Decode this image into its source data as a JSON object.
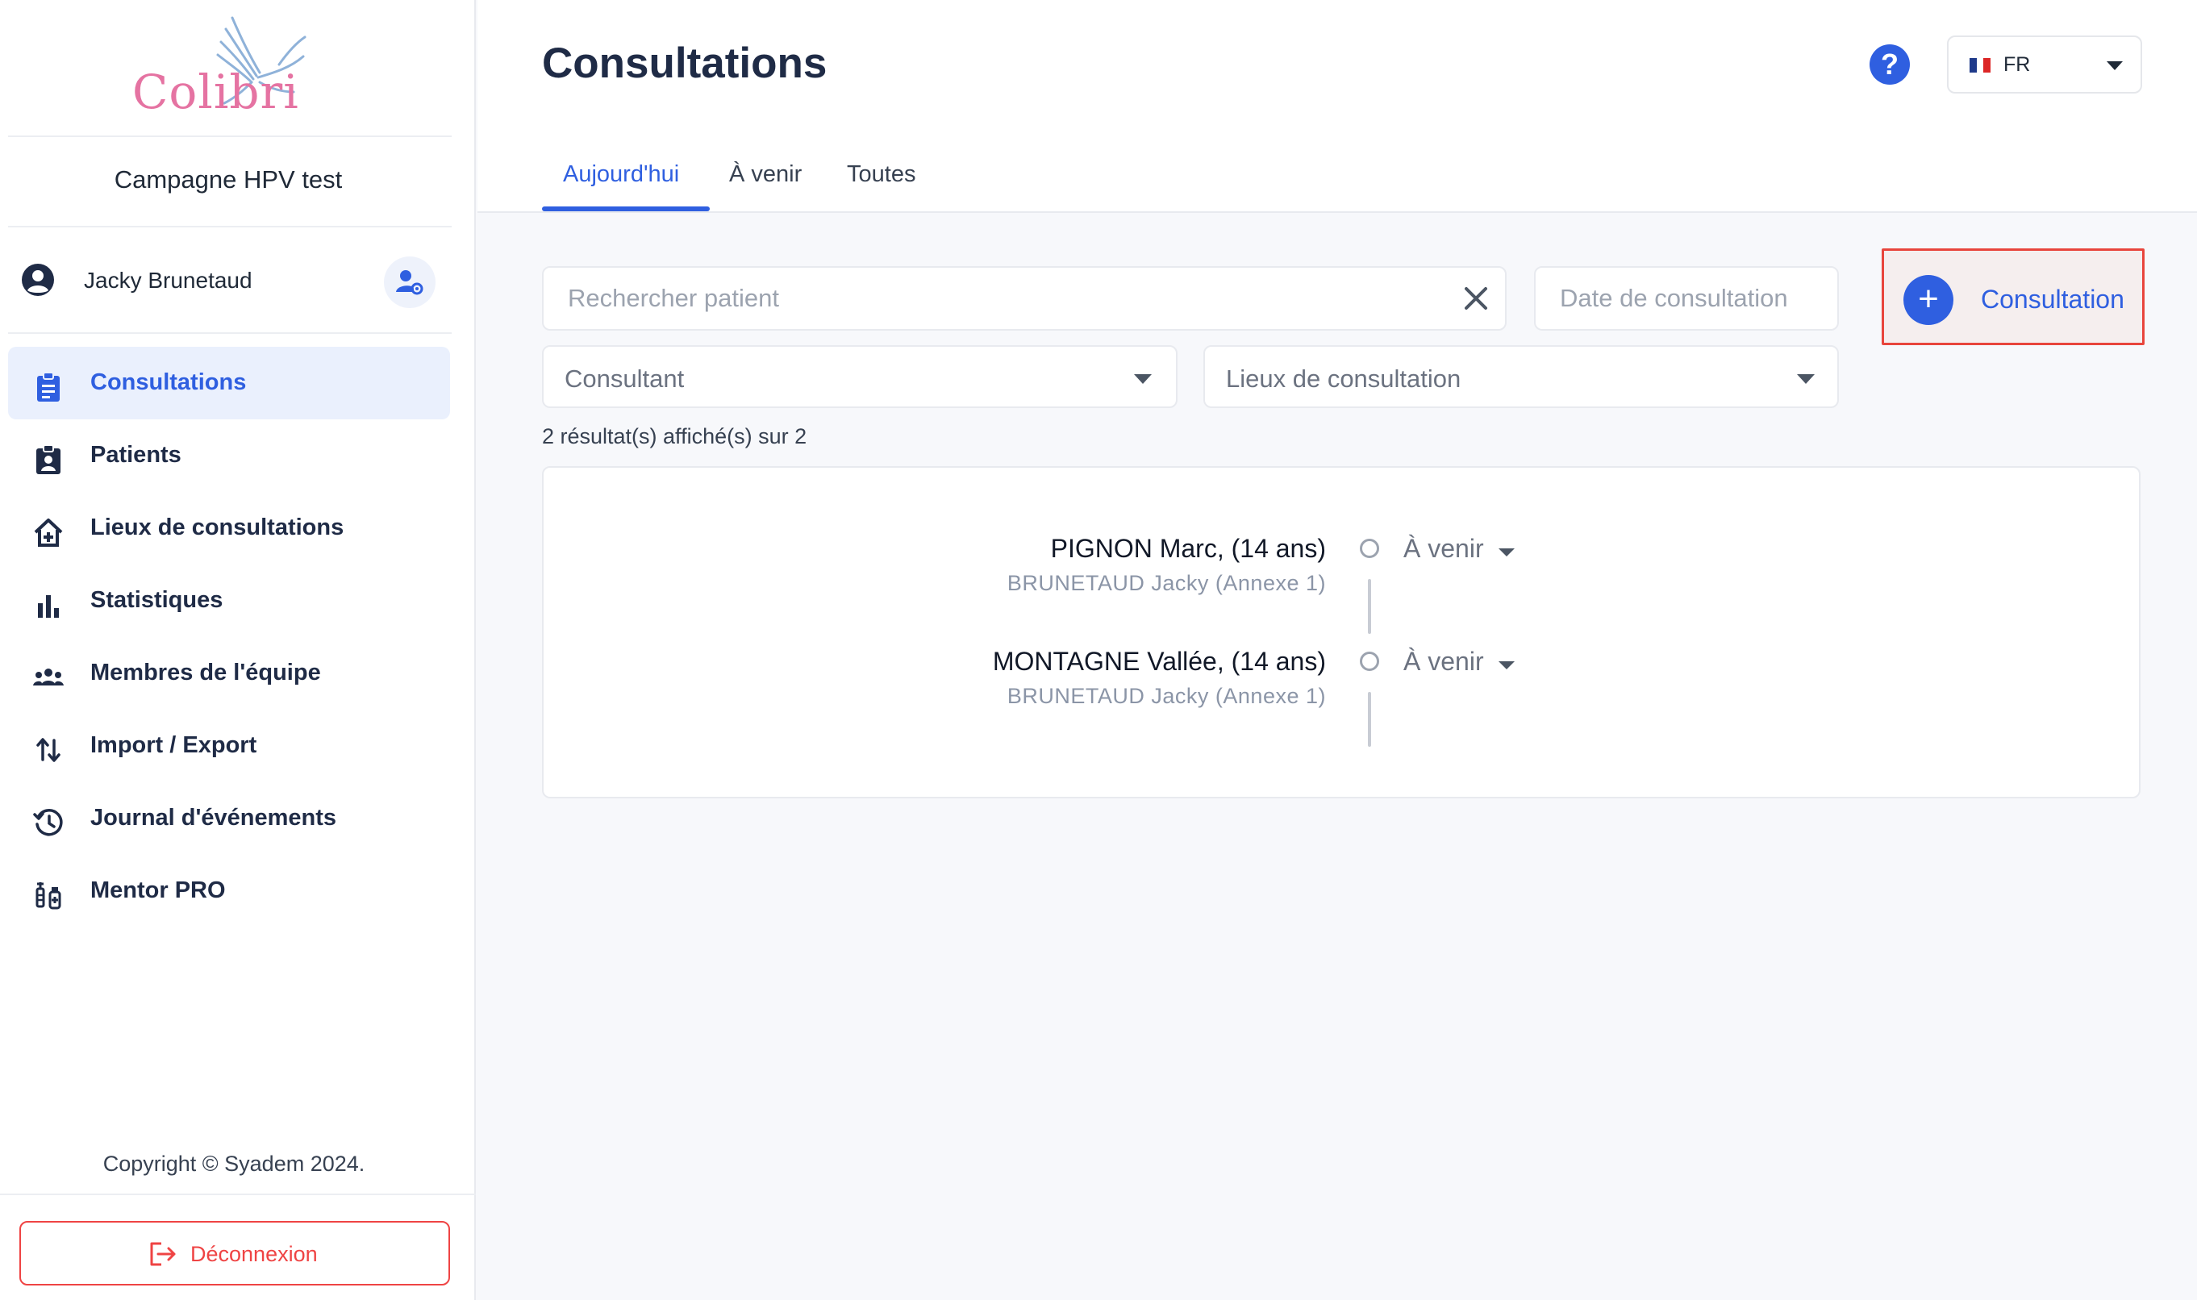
{
  "app": {
    "logo_text": "Colibri",
    "campaign": "Campagne HPV test"
  },
  "user": {
    "name": "Jacky Brunetaud"
  },
  "sidebar": {
    "items": [
      {
        "label": "Consultations",
        "icon": "clipboard-icon",
        "active": true
      },
      {
        "label": "Patients",
        "icon": "patient-badge-icon"
      },
      {
        "label": "Lieux de consultations",
        "icon": "home-plus-icon"
      },
      {
        "label": "Statistiques",
        "icon": "bar-chart-icon"
      },
      {
        "label": "Membres de l'équipe",
        "icon": "team-icon"
      },
      {
        "label": "Import / Export",
        "icon": "swap-vertical-icon"
      },
      {
        "label": "Journal d'événements",
        "icon": "history-icon"
      },
      {
        "label": "Mentor PRO",
        "icon": "vaccine-icon"
      }
    ],
    "copyright": "Copyright © Syadem 2024.",
    "logout_label": "Déconnexion"
  },
  "header": {
    "title": "Consultations",
    "help_label": "?",
    "language": "FR",
    "tabs": [
      {
        "label": "Aujourd'hui",
        "active": true
      },
      {
        "label": "À venir"
      },
      {
        "label": "Toutes"
      }
    ]
  },
  "filters": {
    "search_placeholder": "Rechercher patient",
    "date_placeholder": "Date de consultation",
    "consultant_placeholder": "Consultant",
    "location_placeholder": "Lieux de consultation"
  },
  "add_button": {
    "label": "Consultation",
    "plus": "+"
  },
  "results": {
    "count_text": "2 résultat(s) affiché(s) sur 2",
    "items": [
      {
        "patient": "PIGNON Marc, (14 ans)",
        "consultant": "BRUNETAUD Jacky (Annexe 1)",
        "status": "À venir"
      },
      {
        "patient": "MONTAGNE Vallée, (14 ans)",
        "consultant": "BRUNETAUD Jacky (Annexe 1)",
        "status": "À venir"
      }
    ]
  },
  "colors": {
    "accent": "#2f5fe0",
    "logout": "#ef4444",
    "highlight": "#e8453c",
    "logo": "#e573a2"
  }
}
